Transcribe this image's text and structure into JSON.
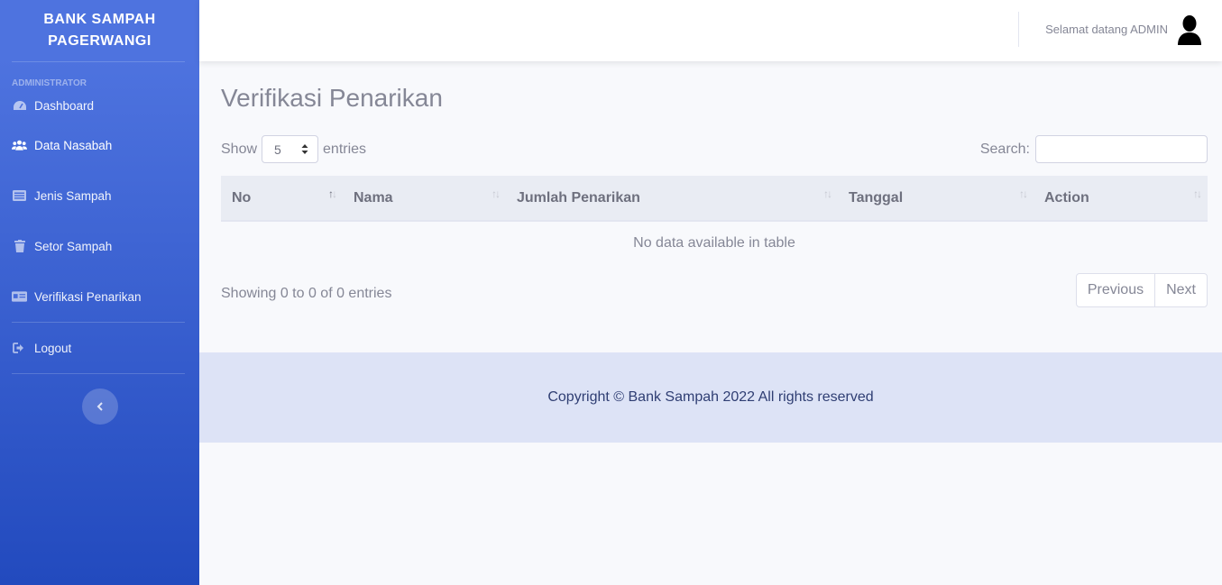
{
  "sidebar": {
    "brand": "BANK SAMPAH PAGERWANGI",
    "heading": "ADMINISTRATOR",
    "items": [
      {
        "label": "Dashboard",
        "icon": "tachometer-icon"
      },
      {
        "label": "Data Nasabah",
        "icon": "users-icon"
      },
      {
        "label": "Jenis Sampah",
        "icon": "list-icon"
      },
      {
        "label": "Setor Sampah",
        "icon": "trash-icon"
      },
      {
        "label": "Verifikasi Penarikan",
        "icon": "id-card-icon"
      }
    ],
    "logout": {
      "label": "Logout",
      "icon": "sign-out-icon"
    },
    "toggle_icon": "chevron-left-icon"
  },
  "topbar": {
    "welcome": "Selamat datang ADMIN",
    "avatar_icon": "user-silhouette-icon"
  },
  "main": {
    "title": "Verifikasi Penarikan",
    "show_label": "Show",
    "entries_label": "entries",
    "page_length": "5",
    "search_label": "Search:",
    "search_value": "",
    "columns": [
      "No",
      "Nama",
      "Jumlah Penarikan",
      "Tanggal",
      "Action"
    ],
    "empty_message": "No data available in table",
    "info": "Showing 0 to 0 of 0 entries",
    "previous_label": "Previous",
    "next_label": "Next"
  },
  "footer": {
    "text": "Copyright © Bank Sampah 2022 All rights reserved"
  },
  "colors": {
    "sidebar_top": "#4e73df",
    "sidebar_bottom": "#224abe",
    "footer_bg": "#dde3f6"
  }
}
